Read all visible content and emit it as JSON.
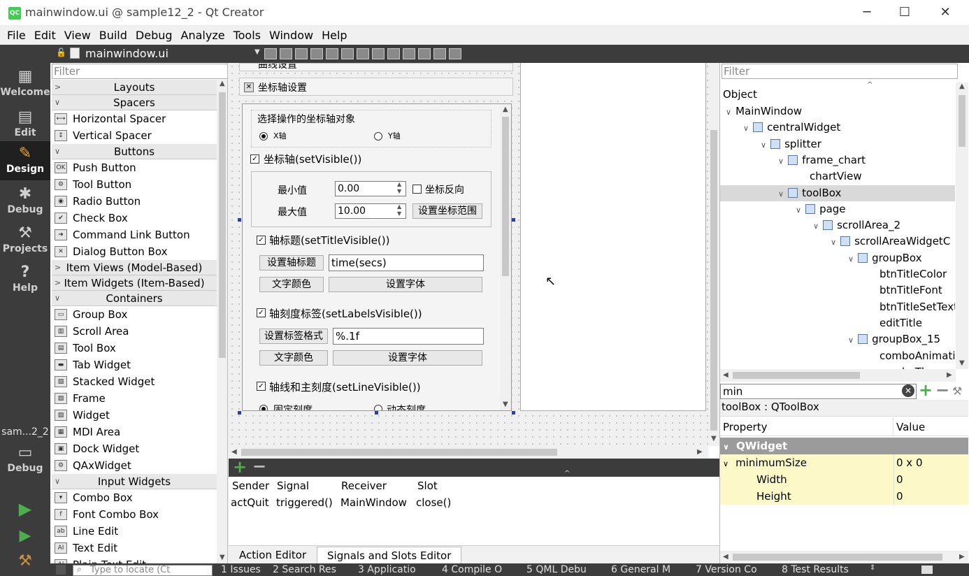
{
  "window": {
    "title": "mainwindow.ui @ sample12_2 - Qt Creator",
    "logo": "QC",
    "minimize": "─",
    "maximize": "☐",
    "close": "✕"
  },
  "menu": [
    "File",
    "Edit",
    "View",
    "Build",
    "Debug",
    "Analyze",
    "Tools",
    "Window",
    "Help"
  ],
  "modes": [
    {
      "label": "Welcome",
      "icon": "grid-icon",
      "glyph": "▦"
    },
    {
      "label": "Edit",
      "icon": "document-icon",
      "glyph": "▤"
    },
    {
      "label": "Design",
      "icon": "pencil-icon",
      "glyph": "✎"
    },
    {
      "label": "Debug",
      "icon": "bug-icon",
      "glyph": "✱"
    },
    {
      "label": "Projects",
      "icon": "wrench-icon",
      "glyph": "⚒"
    },
    {
      "label": "Help",
      "icon": "help-icon",
      "glyph": "?"
    }
  ],
  "kit": {
    "name": "sam...2_2",
    "mode": "Debug"
  },
  "editor": {
    "doc_title": "mainwindow.ui"
  },
  "widgetbox": {
    "filter_placeholder": "Filter",
    "rows": [
      {
        "type": "cat",
        "label": "Layouts",
        "expanded": false
      },
      {
        "type": "cat",
        "label": "Spacers",
        "expanded": true
      },
      {
        "type": "item",
        "label": "Horizontal Spacer",
        "glyph": "⟷"
      },
      {
        "type": "item",
        "label": "Vertical Spacer",
        "glyph": "↕"
      },
      {
        "type": "cat",
        "label": "Buttons",
        "expanded": true
      },
      {
        "type": "item",
        "label": "Push Button",
        "glyph": "OK"
      },
      {
        "type": "item",
        "label": "Tool Button",
        "glyph": "⚙"
      },
      {
        "type": "item",
        "label": "Radio Button",
        "glyph": "◉"
      },
      {
        "type": "item",
        "label": "Check Box",
        "glyph": "✔"
      },
      {
        "type": "item",
        "label": "Command Link Button",
        "glyph": "➜"
      },
      {
        "type": "item",
        "label": "Dialog Button Box",
        "glyph": "✕"
      },
      {
        "type": "cat",
        "label": "Item Views (Model-Based)",
        "expanded": false
      },
      {
        "type": "cat",
        "label": "Item Widgets (Item-Based)",
        "expanded": false
      },
      {
        "type": "cat",
        "label": "Containers",
        "expanded": true
      },
      {
        "type": "item",
        "label": "Group Box",
        "glyph": "▭"
      },
      {
        "type": "item",
        "label": "Scroll Area",
        "glyph": "▥"
      },
      {
        "type": "item",
        "label": "Tool Box",
        "glyph": "▤"
      },
      {
        "type": "item",
        "label": "Tab Widget",
        "glyph": "▬"
      },
      {
        "type": "item",
        "label": "Stacked Widget",
        "glyph": "▧"
      },
      {
        "type": "item",
        "label": "Frame",
        "glyph": "▨"
      },
      {
        "type": "item",
        "label": "Widget",
        "glyph": "▨"
      },
      {
        "type": "item",
        "label": "MDI Area",
        "glyph": "▦"
      },
      {
        "type": "item",
        "label": "Dock Widget",
        "glyph": "▣"
      },
      {
        "type": "item",
        "label": "QAxWidget",
        "glyph": "⚙"
      },
      {
        "type": "cat",
        "label": "Input Widgets",
        "expanded": true
      },
      {
        "type": "item",
        "label": "Combo Box",
        "glyph": "▾"
      },
      {
        "type": "item",
        "label": "Font Combo Box",
        "glyph": "f"
      },
      {
        "type": "item",
        "label": "Line Edit",
        "glyph": "ab"
      },
      {
        "type": "item",
        "label": "Text Edit",
        "glyph": "AI"
      },
      {
        "type": "item",
        "label": "Plain Text Edit",
        "glyph": "AI"
      }
    ]
  },
  "form": {
    "toolbox_page_prev": "曲线设置",
    "toolbox_page_current": "坐标轴设置",
    "axis_select_title": "选择操作的坐标轴对象",
    "radio_x": "X轴",
    "radio_y": "Y轴",
    "axis_visible": "坐标轴(setVisible())",
    "min_label": "最小值",
    "min_value": "0.00",
    "max_label": "最大值",
    "max_value": "10.00",
    "reverse_label": "坐标反向",
    "set_range_btn": "设置坐标范围",
    "title_visible": "轴标题(setTitleVisible())",
    "set_title_btn": "设置轴标题",
    "title_text": "time(secs)",
    "text_color_btn": "文字颜色",
    "set_font_btn": "设置字体",
    "labels_visible": "轴刻度标签(setLabelsVisible())",
    "label_format_btn": "设置标签格式",
    "label_format": "%.1f",
    "text_color_btn2": "文字颜色",
    "set_font_btn2": "设置字体",
    "line_visible": "轴线和主刻度(setLineVisible())",
    "radio_fixed": "固定刻度",
    "radio_dynamic": "动态刻度"
  },
  "signals": {
    "headers": [
      "Sender",
      "Signal",
      "Receiver",
      "Slot"
    ],
    "rows": [
      [
        "actQuit",
        "triggered()",
        "MainWindow",
        "close()"
      ]
    ],
    "tabs": [
      "Action Editor",
      "Signals and Slots Editor"
    ]
  },
  "object_inspector": {
    "filter_placeholder": "Filter",
    "header": "Object",
    "rows": [
      {
        "label": "MainWindow",
        "depth": 0,
        "exp": "v"
      },
      {
        "label": "centralWidget",
        "depth": 1,
        "exp": "v"
      },
      {
        "label": "splitter",
        "depth": 2,
        "exp": "v"
      },
      {
        "label": "frame_chart",
        "depth": 3,
        "exp": "v"
      },
      {
        "label": "chartView",
        "depth": 4,
        "exp": ""
      },
      {
        "label": "toolBox",
        "depth": 3,
        "exp": "v",
        "selected": true
      },
      {
        "label": "page",
        "depth": 4,
        "exp": "v"
      },
      {
        "label": "scrollArea_2",
        "depth": 5,
        "exp": "v"
      },
      {
        "label": "scrollAreaWidgetC",
        "depth": 6,
        "exp": "v"
      },
      {
        "label": "groupBox",
        "depth": 7,
        "exp": "v"
      },
      {
        "label": "btnTitleColor",
        "depth": 8,
        "exp": ""
      },
      {
        "label": "btnTitleFont",
        "depth": 8,
        "exp": ""
      },
      {
        "label": "btnTitleSetText",
        "depth": 8,
        "exp": ""
      },
      {
        "label": "editTitle",
        "depth": 8,
        "exp": ""
      },
      {
        "label": "groupBox_15",
        "depth": 7,
        "exp": "v"
      },
      {
        "label": "comboAnimati",
        "depth": 8,
        "exp": ""
      },
      {
        "label": "comboTheme",
        "depth": 8,
        "exp": ""
      }
    ]
  },
  "property_editor": {
    "filter_value": "min",
    "object_label": "toolBox : QToolBox",
    "col_property": "Property",
    "col_value": "Value",
    "rows": [
      {
        "name": "QWidget",
        "value": "",
        "kind": "section"
      },
      {
        "name": "minimumSize",
        "value": "0 x 0",
        "kind": "parent"
      },
      {
        "name": "Width",
        "value": "0",
        "kind": "child"
      },
      {
        "name": "Height",
        "value": "0",
        "kind": "child"
      }
    ]
  },
  "statusbar": {
    "locate_placeholder": "Type to locate (Ct",
    "panes": [
      "1 Issues",
      "2 Search Res",
      "3 Applicatio",
      "4 Compile O",
      "5 QML Debu",
      "6 General M",
      "7 Version Co",
      "8 Test Results"
    ]
  },
  "colors": {
    "dark_bar": "#3c3c3c",
    "active_mode": "#202020",
    "selection_handle": "#2d3fa0",
    "property_highlight": "#fdf8c8",
    "section_header": "#9b9b9b",
    "run_green": "#4cae4c"
  }
}
